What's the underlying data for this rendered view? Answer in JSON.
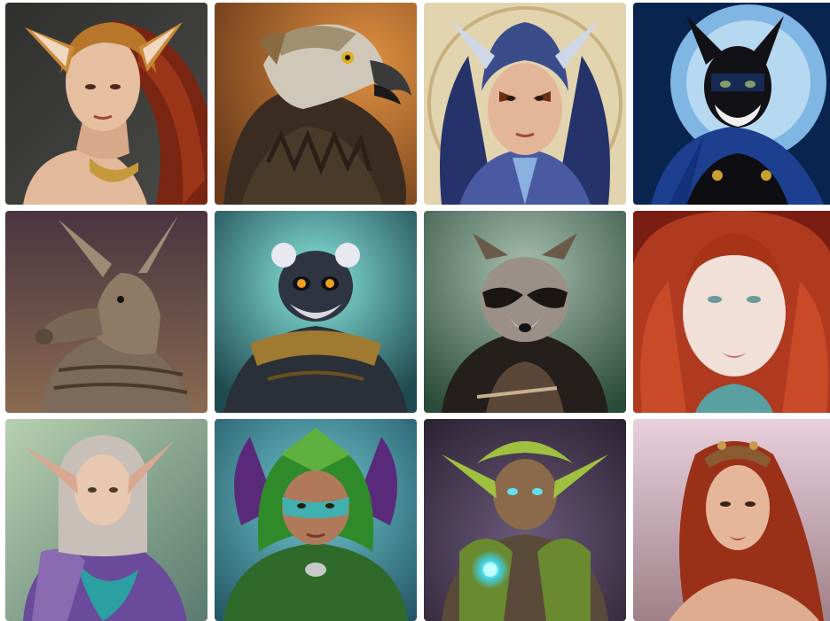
{
  "gallery": {
    "tiles": [
      {
        "subject": "fox-eared-woman-portrait",
        "palette": [
          "#3a3a38",
          "#8a2a14",
          "#c98a3a",
          "#e9c2a6"
        ]
      },
      {
        "subject": "eagle-head-portrait",
        "palette": [
          "#b86a2a",
          "#4a3a2a",
          "#cfc8b8",
          "#2a2018"
        ]
      },
      {
        "subject": "horned-helmet-woman-portrait",
        "palette": [
          "#d9c9a0",
          "#2d3f7a",
          "#5a6ab0",
          "#e3b69a"
        ]
      },
      {
        "subject": "black-cat-masked-hero-portrait",
        "palette": [
          "#0b2a55",
          "#7fb6e3",
          "#0d0d10",
          "#1f4aa0"
        ]
      },
      {
        "subject": "aardvark-armor-portrait",
        "palette": [
          "#5a3a3a",
          "#7c6a5a",
          "#8f7a66",
          "#3a2e24"
        ]
      },
      {
        "subject": "lemur-warrior-portrait",
        "palette": [
          "#2f6f73",
          "#6fd0c8",
          "#222a33",
          "#a07a30"
        ]
      },
      {
        "subject": "raccoon-cloak-portrait",
        "palette": [
          "#3c5a4a",
          "#9ab0a0",
          "#2a2320",
          "#5a4636"
        ]
      },
      {
        "subject": "redhead-freckled-woman-portrait",
        "palette": [
          "#b03a20",
          "#f0e0d8",
          "#7a1e14",
          "#5aa0a0"
        ]
      },
      {
        "subject": "elf-mage-portrait",
        "palette": [
          "#9ac0a0",
          "#6a4a9a",
          "#c8c0b8",
          "#2aa0a0"
        ]
      },
      {
        "subject": "green-hooded-ranger-portrait",
        "palette": [
          "#3a7f8a",
          "#2f7a2a",
          "#5a2a7a",
          "#a06a4a"
        ]
      },
      {
        "subject": "goblin-druid-portrait",
        "palette": [
          "#4a3a5a",
          "#a0c040",
          "#3aa0a0",
          "#6a5a4a"
        ]
      },
      {
        "subject": "crowned-redhead-woman-portrait",
        "palette": [
          "#d8b8c8",
          "#a03a20",
          "#e6b69a",
          "#7a3a3a"
        ]
      }
    ]
  }
}
